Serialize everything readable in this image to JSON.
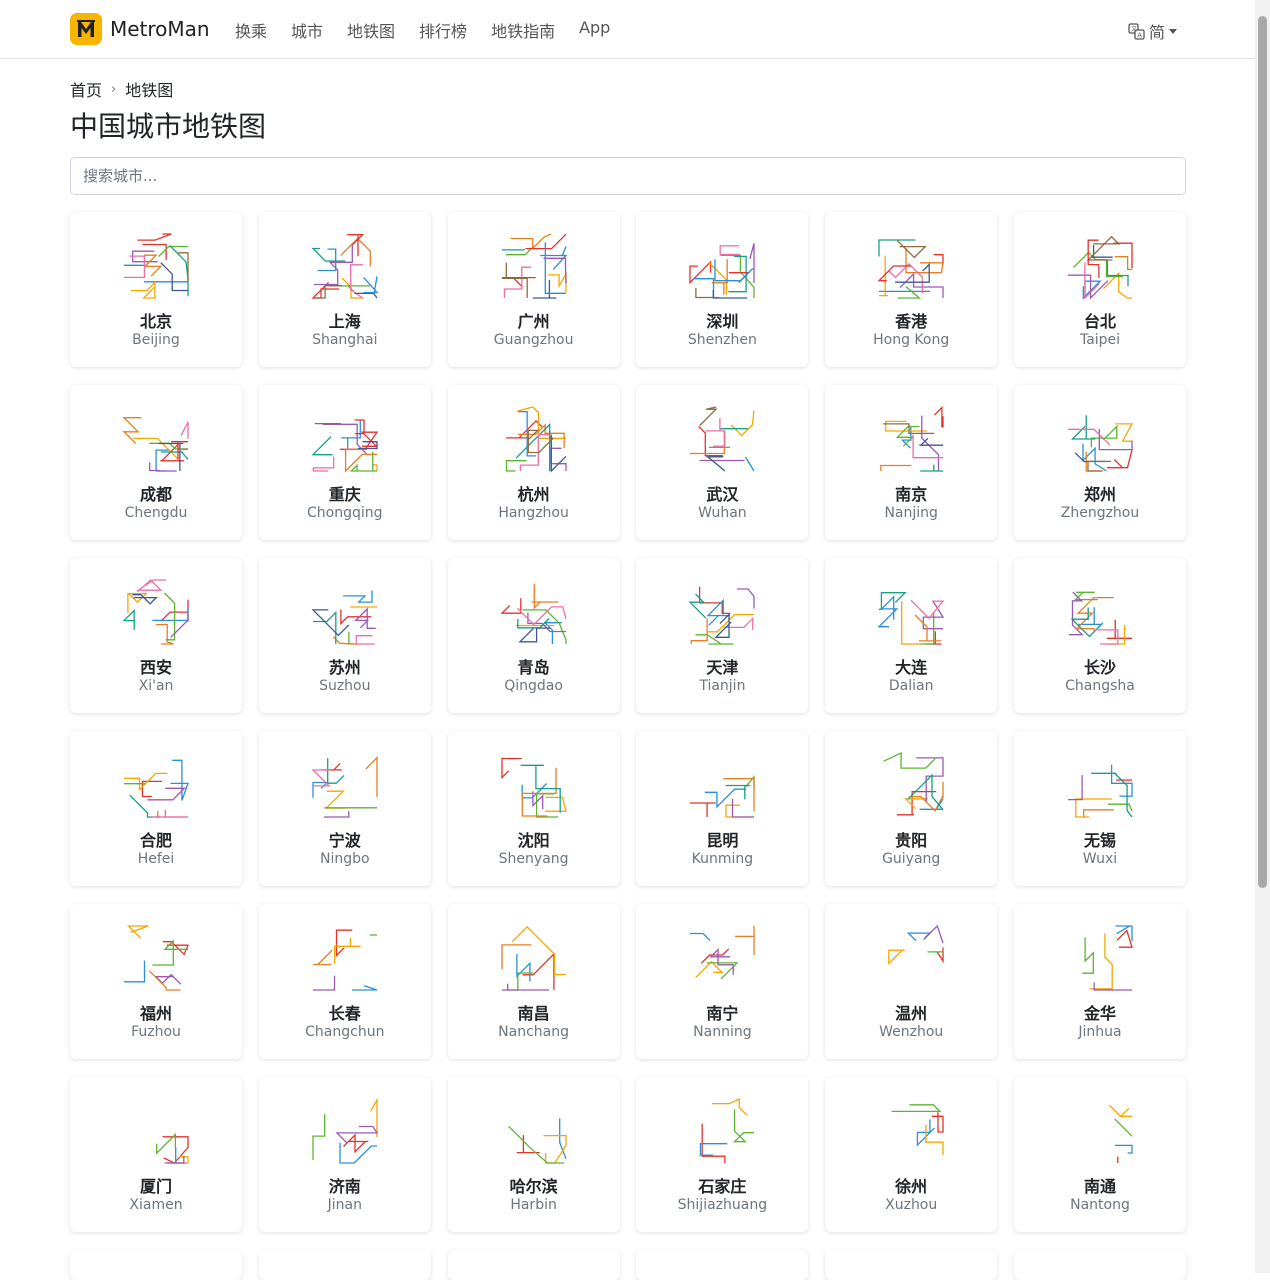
{
  "brand": {
    "name": "MetroMan"
  },
  "nav": [
    "换乘",
    "城市",
    "地铁图",
    "排行榜",
    "地铁指南",
    "App"
  ],
  "language": {
    "label": "简"
  },
  "breadcrumb": {
    "home": "首页",
    "current": "地铁图"
  },
  "page": {
    "title": "中国城市地铁图"
  },
  "search": {
    "placeholder": "搜索城市..."
  },
  "line_colors": [
    "#e4322b",
    "#2a8fdb",
    "#f7a600",
    "#5cb531",
    "#9b59b6",
    "#e67e22",
    "#16a085",
    "#ec6fa6",
    "#3b5998",
    "#8e6c3f"
  ],
  "cities": [
    {
      "cn": "北京",
      "en": "Beijing"
    },
    {
      "cn": "上海",
      "en": "Shanghai"
    },
    {
      "cn": "广州",
      "en": "Guangzhou"
    },
    {
      "cn": "深圳",
      "en": "Shenzhen"
    },
    {
      "cn": "香港",
      "en": "Hong Kong"
    },
    {
      "cn": "台北",
      "en": "Taipei"
    },
    {
      "cn": "成都",
      "en": "Chengdu"
    },
    {
      "cn": "重庆",
      "en": "Chongqing"
    },
    {
      "cn": "杭州",
      "en": "Hangzhou"
    },
    {
      "cn": "武汉",
      "en": "Wuhan"
    },
    {
      "cn": "南京",
      "en": "Nanjing"
    },
    {
      "cn": "郑州",
      "en": "Zhengzhou"
    },
    {
      "cn": "西安",
      "en": "Xi'an"
    },
    {
      "cn": "苏州",
      "en": "Suzhou"
    },
    {
      "cn": "青岛",
      "en": "Qingdao"
    },
    {
      "cn": "天津",
      "en": "Tianjin"
    },
    {
      "cn": "大连",
      "en": "Dalian"
    },
    {
      "cn": "长沙",
      "en": "Changsha"
    },
    {
      "cn": "合肥",
      "en": "Hefei"
    },
    {
      "cn": "宁波",
      "en": "Ningbo"
    },
    {
      "cn": "沈阳",
      "en": "Shenyang"
    },
    {
      "cn": "昆明",
      "en": "Kunming"
    },
    {
      "cn": "贵阳",
      "en": "Guiyang"
    },
    {
      "cn": "无锡",
      "en": "Wuxi"
    },
    {
      "cn": "福州",
      "en": "Fuzhou"
    },
    {
      "cn": "长春",
      "en": "Changchun"
    },
    {
      "cn": "南昌",
      "en": "Nanchang"
    },
    {
      "cn": "南宁",
      "en": "Nanning"
    },
    {
      "cn": "温州",
      "en": "Wenzhou"
    },
    {
      "cn": "金华",
      "en": "Jinhua"
    },
    {
      "cn": "厦门",
      "en": "Xiamen"
    },
    {
      "cn": "济南",
      "en": "Jinan"
    },
    {
      "cn": "哈尔滨",
      "en": "Harbin"
    },
    {
      "cn": "石家庄",
      "en": "Shijiazhuang"
    },
    {
      "cn": "徐州",
      "en": "Xuzhou"
    },
    {
      "cn": "南通",
      "en": "Nantong"
    }
  ]
}
